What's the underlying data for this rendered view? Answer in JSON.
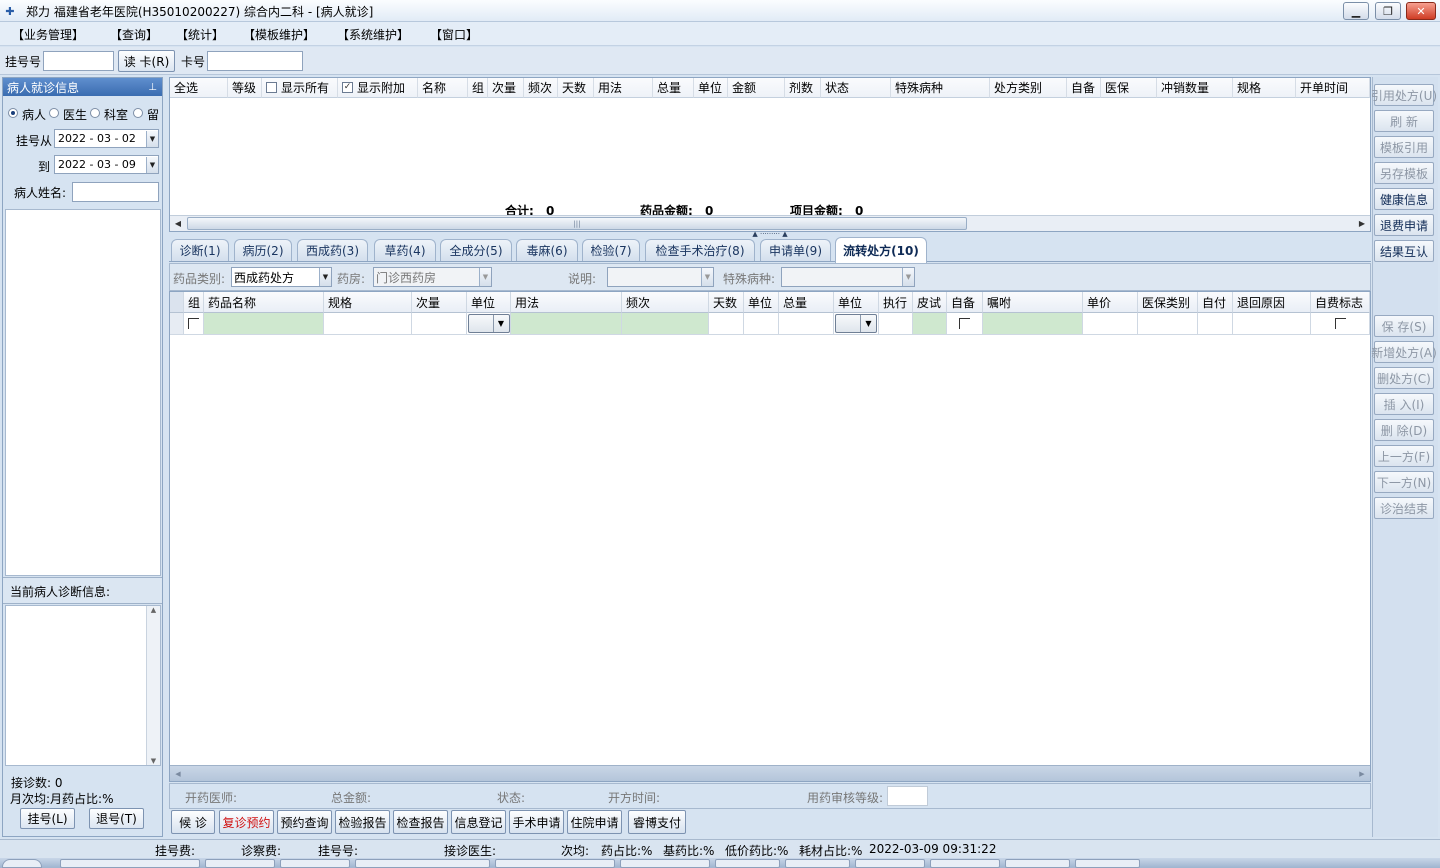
{
  "window": {
    "icon": "app-icon",
    "title": "郑力 福建省老年医院(H35010200227) 综合内二科 - [病人就诊]",
    "minimize": "▁",
    "restore": "❐",
    "close": "✕"
  },
  "menu": [
    "【业务管理】",
    "【查询】",
    "【统计】",
    "【模板维护】",
    "【系统维护】",
    "【窗口】"
  ],
  "toolbar": {
    "reg_no_label": "挂号号",
    "reg_no_value": "",
    "read_card": "读 卡(R)",
    "card_no_label": "卡号",
    "card_no_value": ""
  },
  "left": {
    "panel_title": "病人就诊信息",
    "pin_icon": "pin-icon",
    "radios": [
      "病人",
      "医生",
      "科室",
      "留"
    ],
    "date_from_label": "挂号从",
    "date_from": "2022 - 03 - 02",
    "date_to_label": "到",
    "date_to": "2022 - 03 - 09",
    "name_label": "病人姓名:",
    "name_value": "",
    "diag_title": "当前病人诊断信息:",
    "visit_count": "接诊数: 0",
    "monthly": "月次均:月药占比:%",
    "reg_button": "挂号(L)",
    "unreg_button": "退号(T)"
  },
  "topgrid": {
    "select_all": "全选",
    "level": "等级",
    "show_all": "显示所有",
    "show_extra": "显示附加",
    "columns": [
      "名称",
      "组",
      "次量",
      "频次",
      "天数",
      "用法",
      "总量",
      "单位",
      "金额",
      "剂数",
      "状态",
      "特殊病种",
      "处方类别",
      "自备",
      "医保",
      "冲销数量",
      "规格",
      "开单时间"
    ],
    "total_label": "合计:",
    "total_value": "0",
    "drug_amount_label": "药品金额:",
    "drug_amount_value": "0",
    "item_amount_label": "项目金额:",
    "item_amount_value": "0",
    "splitter": "▲ ········· ▲"
  },
  "tabs": [
    "诊断(1)",
    "病历(2)",
    "西成药(3)",
    "草药(4)",
    "全成分(5)",
    "毒麻(6)",
    "检验(7)",
    "检查手术治疗(8)",
    "申请单(9)",
    "流转处方(10)"
  ],
  "filter": {
    "drug_type_label": "药品类别:",
    "drug_type_value": "西成药处方",
    "pharmacy_label": "药房:",
    "pharmacy_value": "门诊西药房",
    "note_label": "说明:",
    "note_value": "",
    "special_label": "特殊病种:",
    "special_value": ""
  },
  "detail": {
    "columns": [
      "组",
      "药品名称",
      "规格",
      "次量",
      "单位",
      "用法",
      "频次",
      "天数",
      "单位",
      "总量",
      "单位",
      "执行",
      "皮试",
      "自备",
      "嘱咐",
      "单价",
      "医保类别",
      "自付",
      "退回原因",
      "自费标志"
    ]
  },
  "info": {
    "doctor_label": "开药医师:",
    "total_label": "总金额:",
    "status_label": "状态:",
    "time_label": "开方时间:",
    "audit_label": "用药审核等级:"
  },
  "actions": [
    "候 诊",
    "复诊预约",
    "预约查询",
    "检验报告",
    "检查报告",
    "信息登记",
    "手术申请",
    "住院申请",
    "睿博支付"
  ],
  "right_top": [
    "引用处方(U)",
    "刷 新",
    "模板引用",
    "另存模板",
    "健康信息",
    "退费申请",
    "结果互认"
  ],
  "right_bottom": [
    "保 存(S)",
    "新增处方(A)",
    "删处方(C)",
    "插 入(I)",
    "删 除(D)",
    "上一方(F)",
    "下一方(N)",
    "诊治结束"
  ],
  "status": {
    "reg_fee": "挂号费:",
    "consult_fee": "诊察费:",
    "reg_no": "挂号号:",
    "doctor": "接诊医生:",
    "avg": "次均:",
    "drug_ratio": "药占比:%",
    "basic_drug": "基药比:%",
    "low_price": "低价药比:%",
    "material": "耗材占比:%",
    "datetime": "2022-03-09 09:31:22"
  }
}
